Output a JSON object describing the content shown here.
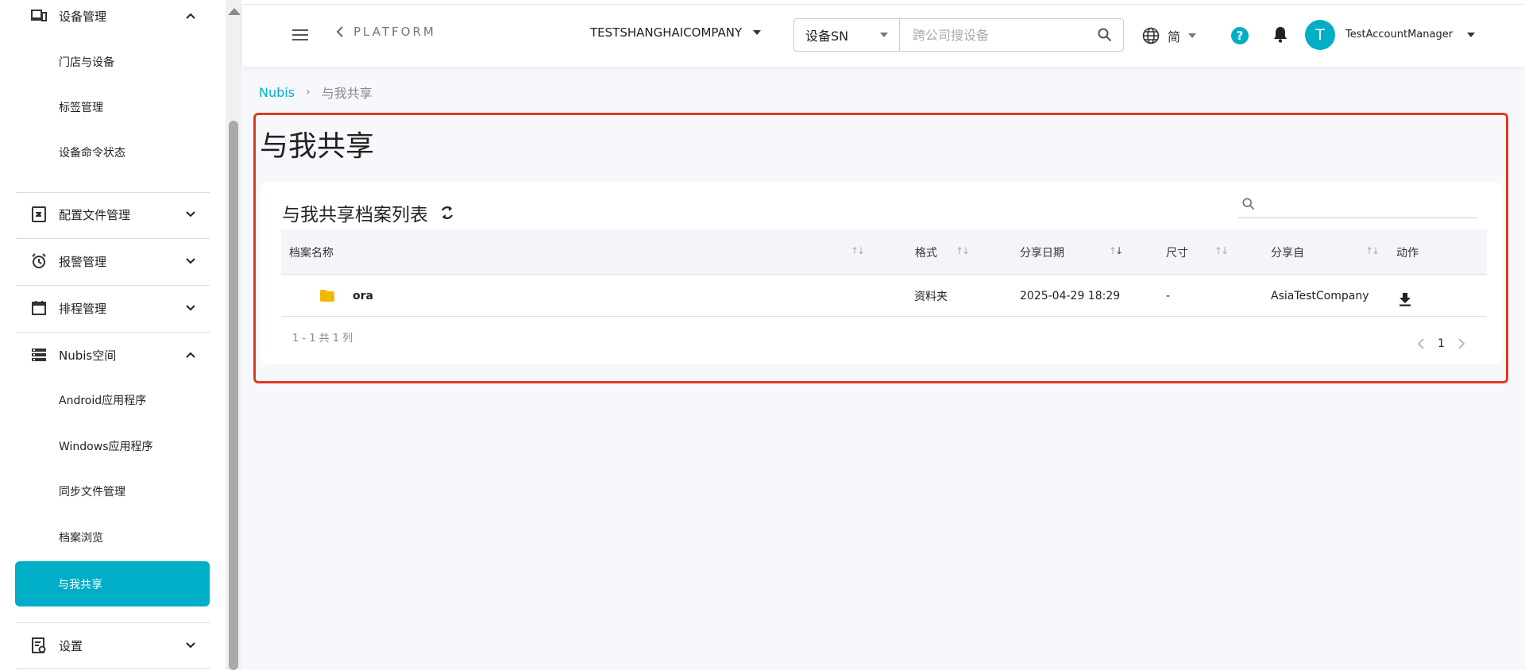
{
  "sidebar": {
    "groups": [
      {
        "label": "设备管理",
        "icon": "devices-icon",
        "expanded": true
      },
      {
        "label": "配置文件管理",
        "icon": "config-file-icon",
        "expanded": false
      },
      {
        "label": "报警管理",
        "icon": "alarm-clock-icon",
        "expanded": false
      },
      {
        "label": "排程管理",
        "icon": "calendar-icon",
        "expanded": false
      },
      {
        "label": "Nubis空间",
        "icon": "storage-icon",
        "expanded": true
      },
      {
        "label": "设置",
        "icon": "settings-document-icon",
        "expanded": false
      }
    ],
    "device_items": [
      "门店与设备",
      "标签管理",
      "设备命令状态"
    ],
    "nubis_items": [
      "Android应用程序",
      "Windows应用程序",
      "同步文件管理",
      "档案浏览",
      "与我共享"
    ],
    "active_item": "与我共享"
  },
  "topbar": {
    "back_label": "PLATFORM",
    "company": "TESTSHANGHAICOMPANY",
    "search_type": "设备SN",
    "search_placeholder": "跨公司搜设备",
    "language": "简",
    "help_label": "?",
    "avatar_letter": "T",
    "username": "TestAccountManager"
  },
  "breadcrumb": {
    "root": "Nubis",
    "current": "与我共享"
  },
  "page": {
    "title": "与我共享"
  },
  "card": {
    "title": "与我共享档案列表",
    "search_placeholder": "",
    "columns": [
      "档案名称",
      "格式",
      "分享日期",
      "尺寸",
      "分享自",
      "动作"
    ],
    "rows": [
      {
        "name": "ora",
        "format": "资料夹",
        "date": "2025-04-29 18:29",
        "size": "-",
        "shared_from": "AsiaTestCompany"
      }
    ],
    "pagination_info": "1 - 1 共 1 列",
    "current_page": "1"
  },
  "colors": {
    "accent": "#00aec7",
    "highlight": "#e03b24",
    "folder": "#f2b705"
  }
}
